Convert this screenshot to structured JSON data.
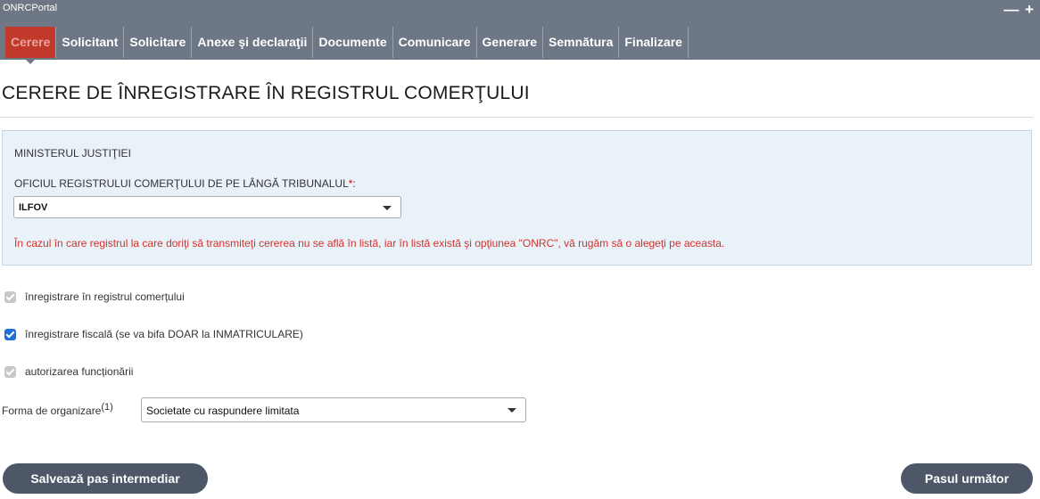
{
  "portal": {
    "title": "ONRCPortal",
    "minimize_symbol": "—",
    "expand_symbol": "+"
  },
  "tabs": [
    {
      "label": "Cerere",
      "active": true
    },
    {
      "label": "Solicitant",
      "active": false
    },
    {
      "label": "Solicitare",
      "active": false
    },
    {
      "label": "Anexe şi declaraţii",
      "active": false
    },
    {
      "label": "Documente",
      "active": false
    },
    {
      "label": "Comunicare",
      "active": false
    },
    {
      "label": "Generare",
      "active": false
    },
    {
      "label": "Semnătura",
      "active": false
    },
    {
      "label": "Finalizare",
      "active": false
    }
  ],
  "page": {
    "title": "CERERE DE ÎNREGISTRARE ÎN REGISTRUL COMERŢULUI"
  },
  "info_box": {
    "ministry": "MINISTERUL JUSTIŢIEI",
    "office_label": "OFICIUL REGISTRULUI COMERŢULUI DE PE LÂNGĂ TRIBUNALUL",
    "required_marker": "*",
    "label_suffix": ":",
    "office_value": "ILFOV",
    "warning": "În cazul în care registrul la care doriţi să transmiteţi cererea nu se află în listă, iar în listă există şi opţiunea \"ONRC\", vă rugăm să o alegeţi pe aceasta."
  },
  "options": [
    {
      "label": "înregistrare în registrul comerțului",
      "checked": true,
      "disabled": true
    },
    {
      "label": "înregistrare fiscală (se va bifa DOAR la INMATRICULARE)",
      "checked": true,
      "disabled": false
    },
    {
      "label": "autorizarea funcționării",
      "checked": true,
      "disabled": true
    }
  ],
  "organization": {
    "label": "Forma de organizare",
    "footnote": "(1)",
    "value": "Societate cu raspundere limitata"
  },
  "buttons": {
    "save": "Salvează pas intermediar",
    "next": "Pasul următor"
  },
  "colors": {
    "header_bg": "#6d7785",
    "active_tab": "#c0392b",
    "warning_text": "#d0342c",
    "info_bg": "#e9f1f9",
    "button_bg": "#4d5767"
  }
}
